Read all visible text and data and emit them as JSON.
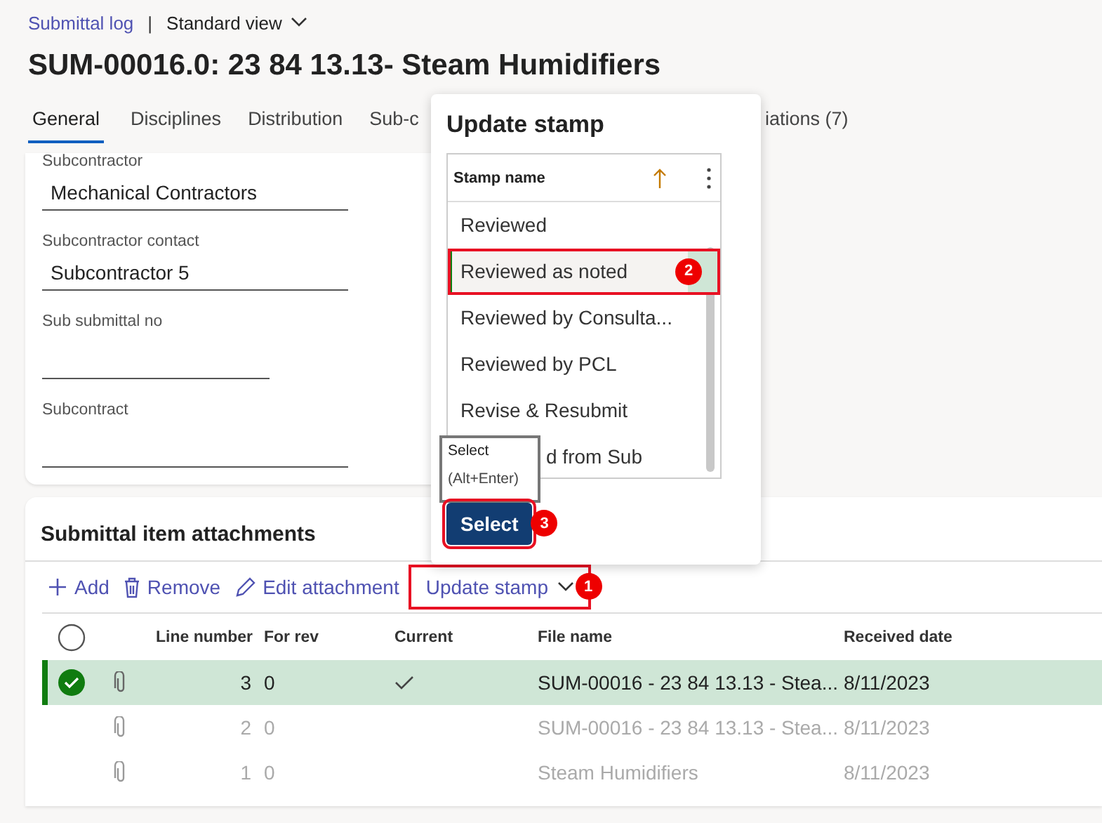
{
  "breadcrumb": {
    "link": "Submittal log",
    "separator": "|",
    "view": "Standard view"
  },
  "title": "SUM-00016.0: 23 84 13.13- Steam Humidifiers",
  "tabs": [
    {
      "label": "General",
      "selected": true
    },
    {
      "label": "Disciplines",
      "selected": false
    },
    {
      "label": "Distribution",
      "selected": false
    },
    {
      "label": "Sub-c",
      "selected": false
    },
    {
      "label": "iations (7)",
      "selected": false
    }
  ],
  "fields": [
    {
      "label": "Subcontractor",
      "value": "Mechanical Contractors"
    },
    {
      "label": "Subcontractor contact",
      "value": "Subcontractor 5"
    },
    {
      "label": "Sub submittal no"
    },
    {
      "label": "Subcontract"
    }
  ],
  "attachments": {
    "title": "Submittal item attachments",
    "toolbar": [
      {
        "kind": "add",
        "label": "Add"
      },
      {
        "kind": "remove",
        "label": "Remove"
      },
      {
        "kind": "edit",
        "label": "Edit attachment"
      },
      {
        "kind": "menu",
        "label": "Update stamp",
        "callout": "1"
      }
    ],
    "columns": [
      "Line number",
      "For rev",
      "Current",
      "File name",
      "Received date"
    ],
    "rows": [
      {
        "selected": true,
        "dimmed": false,
        "line": "3",
        "rev": "0",
        "current": true,
        "file": "SUM-00016 - 23 84 13.13 - Stea...",
        "date": "8/11/2023"
      },
      {
        "selected": false,
        "dimmed": true,
        "line": "2",
        "rev": "0",
        "current": false,
        "file": "SUM-00016 - 23 84 13.13 - Stea...",
        "date": "8/11/2023"
      },
      {
        "selected": false,
        "dimmed": true,
        "line": "1",
        "rev": "0",
        "current": false,
        "file": "Steam Humidifiers",
        "date": "8/11/2023"
      }
    ]
  },
  "popup": {
    "title": "Update stamp",
    "column": "Stamp name",
    "items": [
      {
        "label": "Reviewed",
        "selected": false
      },
      {
        "label": "Reviewed as noted",
        "selected": true,
        "callout": "2"
      },
      {
        "label": "Reviewed by Consulta...",
        "selected": false
      },
      {
        "label": "Reviewed by PCL",
        "selected": false
      },
      {
        "label": "Revise & Resubmit",
        "selected": false
      },
      {
        "label": "d from Sub",
        "selected": false,
        "kind": "partial"
      }
    ],
    "tooltip": {
      "title": "Select",
      "shortcut": "(Alt+Enter)"
    },
    "button": {
      "label": "Select",
      "callout": "3"
    }
  }
}
